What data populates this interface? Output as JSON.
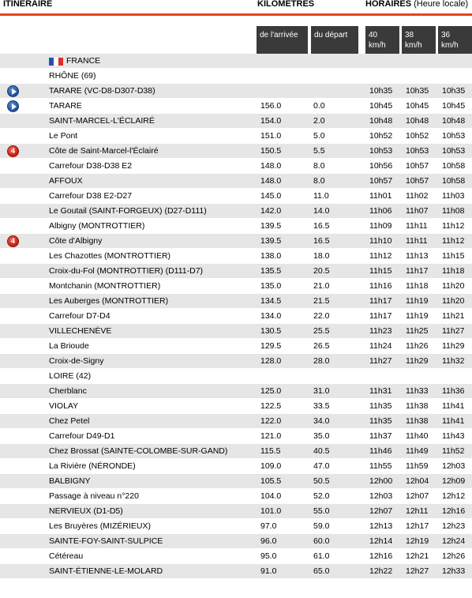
{
  "header": {
    "itineraire": "ITINERAIRE",
    "kilometres": "KILOMETRES",
    "horaires": "HORAIRES",
    "horaires_note": "(Heure locale)",
    "arrivee": "de l'arrivée",
    "depart": "du départ",
    "speeds": [
      "40 km/h",
      "38 km/h",
      "36 km/h"
    ]
  },
  "rows": [
    {
      "kind": "flag",
      "name": "FRANCE"
    },
    {
      "kind": "group",
      "name": "RHÔNE (69)"
    },
    {
      "kind": "row",
      "icon": "play",
      "name": "TARARE (VC-D8-D307-D38)",
      "arr": "",
      "dep": "",
      "t40": "10h35",
      "t38": "10h35",
      "t36": "10h35"
    },
    {
      "kind": "row",
      "icon": "play",
      "name": "TARARE",
      "arr": "156.0",
      "dep": "0.0",
      "t40": "10h45",
      "t38": "10h45",
      "t36": "10h45"
    },
    {
      "kind": "row",
      "icon": "",
      "name": "SAINT-MARCEL-L'ÉCLAIRÉ",
      "arr": "154.0",
      "dep": "2.0",
      "t40": "10h48",
      "t38": "10h48",
      "t36": "10h48"
    },
    {
      "kind": "row",
      "icon": "",
      "name": "Le Pont",
      "arr": "151.0",
      "dep": "5.0",
      "t40": "10h52",
      "t38": "10h52",
      "t36": "10h53"
    },
    {
      "kind": "row",
      "icon": "cat4",
      "name": "Côte de Saint-Marcel-l'Éclairé",
      "arr": "150.5",
      "dep": "5.5",
      "t40": "10h53",
      "t38": "10h53",
      "t36": "10h53"
    },
    {
      "kind": "row",
      "icon": "",
      "name": "Carrefour D38-D38 E2",
      "arr": "148.0",
      "dep": "8.0",
      "t40": "10h56",
      "t38": "10h57",
      "t36": "10h58"
    },
    {
      "kind": "row",
      "icon": "",
      "name": "AFFOUX",
      "arr": "148.0",
      "dep": "8.0",
      "t40": "10h57",
      "t38": "10h57",
      "t36": "10h58"
    },
    {
      "kind": "row",
      "icon": "",
      "name": "Carrefour D38 E2-D27",
      "arr": "145.0",
      "dep": "11.0",
      "t40": "11h01",
      "t38": "11h02",
      "t36": "11h03"
    },
    {
      "kind": "row",
      "icon": "",
      "name": "Le Goutail (SAINT-FORGEUX) (D27-D111)",
      "arr": "142.0",
      "dep": "14.0",
      "t40": "11h06",
      "t38": "11h07",
      "t36": "11h08"
    },
    {
      "kind": "row",
      "icon": "",
      "name": "Albigny (MONTROTTIER)",
      "arr": "139.5",
      "dep": "16.5",
      "t40": "11h09",
      "t38": "11h11",
      "t36": "11h12"
    },
    {
      "kind": "row",
      "icon": "cat4",
      "name": "Côte d'Albigny",
      "arr": "139.5",
      "dep": "16.5",
      "t40": "11h10",
      "t38": "11h11",
      "t36": "11h12"
    },
    {
      "kind": "row",
      "icon": "",
      "name": "Les Chazottes (MONTROTTIER)",
      "arr": "138.0",
      "dep": "18.0",
      "t40": "11h12",
      "t38": "11h13",
      "t36": "11h15"
    },
    {
      "kind": "row",
      "icon": "",
      "name": "Croix-du-Fol (MONTROTTIER) (D111-D7)",
      "arr": "135.5",
      "dep": "20.5",
      "t40": "11h15",
      "t38": "11h17",
      "t36": "11h18"
    },
    {
      "kind": "row",
      "icon": "",
      "name": "Montchanin (MONTROTTIER)",
      "arr": "135.0",
      "dep": "21.0",
      "t40": "11h16",
      "t38": "11h18",
      "t36": "11h20"
    },
    {
      "kind": "row",
      "icon": "",
      "name": "Les Auberges (MONTROTTIER)",
      "arr": "134.5",
      "dep": "21.5",
      "t40": "11h17",
      "t38": "11h19",
      "t36": "11h20"
    },
    {
      "kind": "row",
      "icon": "",
      "name": "Carrefour D7-D4",
      "arr": "134.0",
      "dep": "22.0",
      "t40": "11h17",
      "t38": "11h19",
      "t36": "11h21"
    },
    {
      "kind": "row",
      "icon": "",
      "name": "VILLECHENÈVE",
      "arr": "130.5",
      "dep": "25.5",
      "t40": "11h23",
      "t38": "11h25",
      "t36": "11h27"
    },
    {
      "kind": "row",
      "icon": "",
      "name": "La Brioude",
      "arr": "129.5",
      "dep": "26.5",
      "t40": "11h24",
      "t38": "11h26",
      "t36": "11h29"
    },
    {
      "kind": "row",
      "icon": "",
      "name": "Croix-de-Signy",
      "arr": "128.0",
      "dep": "28.0",
      "t40": "11h27",
      "t38": "11h29",
      "t36": "11h32"
    },
    {
      "kind": "group",
      "name": "LOIRE (42)"
    },
    {
      "kind": "row",
      "icon": "",
      "name": "Cherblanc",
      "arr": "125.0",
      "dep": "31.0",
      "t40": "11h31",
      "t38": "11h33",
      "t36": "11h36"
    },
    {
      "kind": "row",
      "icon": "",
      "name": "VIOLAY",
      "arr": "122.5",
      "dep": "33.5",
      "t40": "11h35",
      "t38": "11h38",
      "t36": "11h41"
    },
    {
      "kind": "row",
      "icon": "",
      "name": "Chez Petel",
      "arr": "122.0",
      "dep": "34.0",
      "t40": "11h35",
      "t38": "11h38",
      "t36": "11h41"
    },
    {
      "kind": "row",
      "icon": "",
      "name": "Carrefour D49-D1",
      "arr": "121.0",
      "dep": "35.0",
      "t40": "11h37",
      "t38": "11h40",
      "t36": "11h43"
    },
    {
      "kind": "row",
      "icon": "",
      "name": "Chez Brossat (SAINTE-COLOMBE-SUR-GAND)",
      "arr": "115.5",
      "dep": "40.5",
      "t40": "11h46",
      "t38": "11h49",
      "t36": "11h52"
    },
    {
      "kind": "row",
      "icon": "",
      "name": "La Rivière (NÉRONDE)",
      "arr": "109.0",
      "dep": "47.0",
      "t40": "11h55",
      "t38": "11h59",
      "t36": "12h03"
    },
    {
      "kind": "row",
      "icon": "",
      "name": "BALBIGNY",
      "arr": "105.5",
      "dep": "50.5",
      "t40": "12h00",
      "t38": "12h04",
      "t36": "12h09"
    },
    {
      "kind": "row",
      "icon": "",
      "name": "Passage à niveau n°220",
      "arr": "104.0",
      "dep": "52.0",
      "t40": "12h03",
      "t38": "12h07",
      "t36": "12h12"
    },
    {
      "kind": "row",
      "icon": "",
      "name": "NERVIEUX (D1-D5)",
      "arr": "101.0",
      "dep": "55.0",
      "t40": "12h07",
      "t38": "12h11",
      "t36": "12h16"
    },
    {
      "kind": "row",
      "icon": "",
      "name": "Les Bruyères (MIZÉRIEUX)",
      "arr": "97.0",
      "dep": "59.0",
      "t40": "12h13",
      "t38": "12h17",
      "t36": "12h23"
    },
    {
      "kind": "row",
      "icon": "",
      "name": "SAINTE-FOY-SAINT-SULPICE",
      "arr": "96.0",
      "dep": "60.0",
      "t40": "12h14",
      "t38": "12h19",
      "t36": "12h24"
    },
    {
      "kind": "row",
      "icon": "",
      "name": "Cétéreau",
      "arr": "95.0",
      "dep": "61.0",
      "t40": "12h16",
      "t38": "12h21",
      "t36": "12h26"
    },
    {
      "kind": "row",
      "icon": "",
      "name": "SAINT-ÉTIENNE-LE-MOLARD",
      "arr": "91.0",
      "dep": "65.0",
      "t40": "12h22",
      "t38": "12h27",
      "t36": "12h33"
    }
  ],
  "colors": {
    "accent": "#e8431c",
    "header_cell": "#3a3a3a",
    "row_alt": "#e6e6e6"
  }
}
